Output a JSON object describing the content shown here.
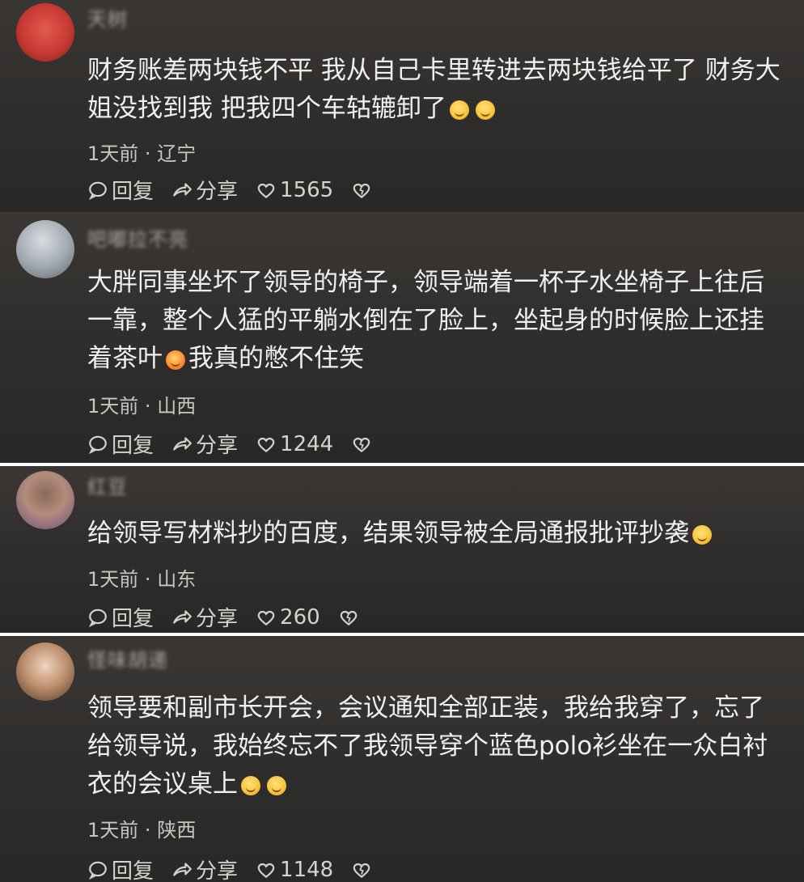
{
  "comments": [
    {
      "username": "天树",
      "text": "财务账差两块钱不平 我从自己卡里转进去两块钱给平了 财务大姐没找到我 把我四个车轱辘卸了",
      "time": "1天前",
      "location": "辽宁",
      "reply_label": "回复",
      "share_label": "分享",
      "likes": "1565"
    },
    {
      "username": "吧嘟拉不亮",
      "text": "大胖同事坐坏了领导的椅子，领导端着一杯子水坐椅子上往后一靠，整个人猛的平躺水倒在了脸上，坐起身的时候脸上还挂着茶叶",
      "text_tail": "我真的憋不住笑",
      "time": "1天前",
      "location": "山西",
      "reply_label": "回复",
      "share_label": "分享",
      "likes": "1244"
    },
    {
      "username": "红豆",
      "text": "给领导写材料抄的百度，结果领导被全局通报批评抄袭",
      "time": "1天前",
      "location": "山东",
      "reply_label": "回复",
      "share_label": "分享",
      "likes": "260"
    },
    {
      "username": "怪味胡递",
      "text": "领导要和副市长开会，会议通知全部正装，我给我穿了，忘了给领导说，我始终忘不了我领导穿个蓝色polo衫坐在一众白衬衣的会议桌上",
      "time": "1天前",
      "location": "陕西",
      "reply_label": "回复",
      "share_label": "分享",
      "likes": "1148"
    }
  ],
  "meta_separator": "·",
  "icons": [
    "reply-bubble-icon",
    "share-arrow-icon",
    "heart-icon",
    "dislike-heart-icon",
    "emoji-icon"
  ],
  "colors": {
    "background": "#2f2d2b",
    "text": "#f2f0ee",
    "muted": "#a9a4a0"
  }
}
